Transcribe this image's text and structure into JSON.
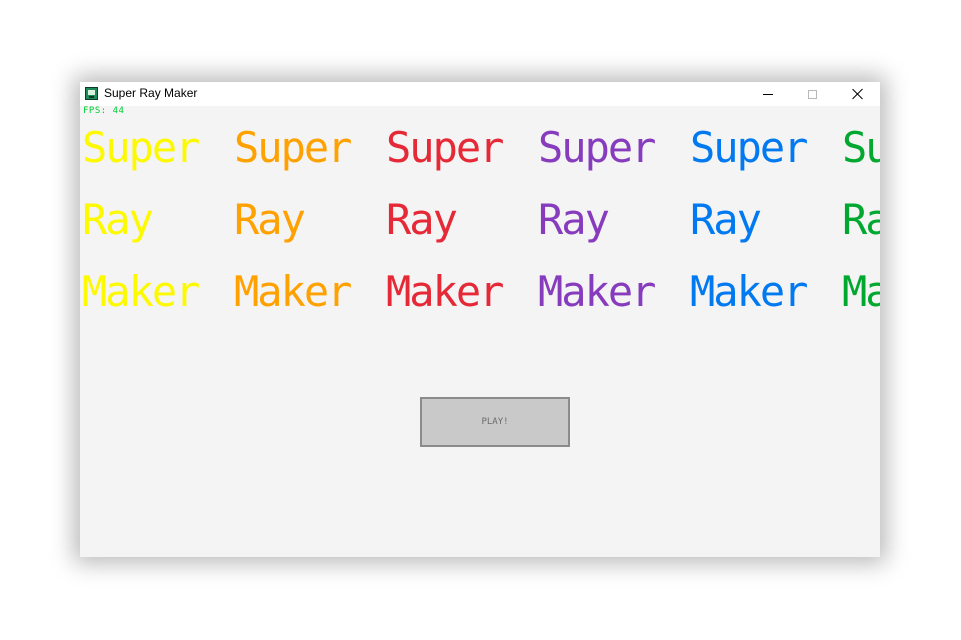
{
  "window": {
    "title": "Super Ray Maker",
    "icon": "game-app-icon",
    "controls": [
      "minimize-icon",
      "maximize-icon",
      "close-icon"
    ]
  },
  "game": {
    "fps_text": "FPS: 44",
    "title_columns": [
      {
        "color": "#fdf900",
        "words": [
          "Super",
          "Ray",
          "Maker"
        ]
      },
      {
        "color": "#ffa100",
        "words": [
          "Super",
          "Ray",
          "Maker"
        ]
      },
      {
        "color": "#e62937",
        "words": [
          "Super",
          "Ray",
          "Maker"
        ]
      },
      {
        "color": "#873cbe",
        "words": [
          "Super",
          "Ray",
          "Maker"
        ]
      },
      {
        "color": "#0079f1",
        "words": [
          "Super",
          "Ray",
          "Maker"
        ]
      },
      {
        "color": "#00a830",
        "words": [
          "Super",
          "Ray",
          "Maker"
        ]
      }
    ],
    "play_button_label": "PLAY!",
    "colors": {
      "background": "#f4f4f4",
      "fps": "#00cc33",
      "button_bg": "#c9c9c9",
      "button_border": "#8b8b8b",
      "button_text": "#6b6b6b"
    }
  }
}
